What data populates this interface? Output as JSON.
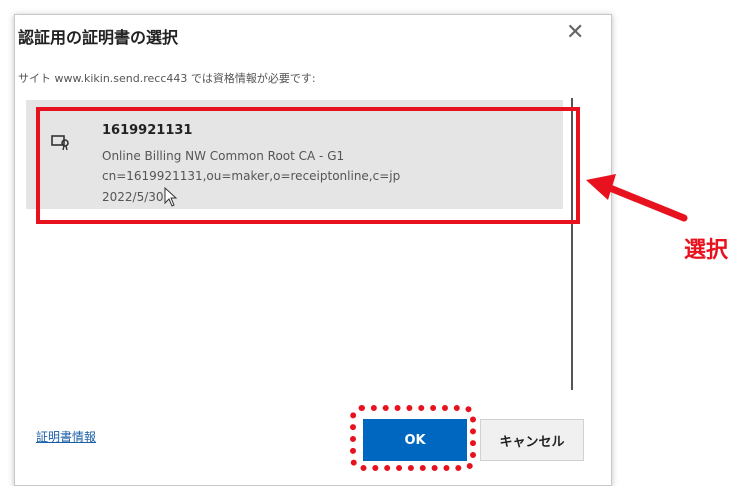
{
  "dialog": {
    "title": "認証用の証明書の選択",
    "subtitle": "サイト www.kikin.send.recc443 では資格情報が必要です:",
    "close_icon": "close-icon"
  },
  "certificate": {
    "name": "1619921131",
    "issuer": "Online Billing NW Common Root CA - G1",
    "subject": "cn=1619921131,ou=maker,o=receiptonline,c=jp",
    "date": "2022/5/30",
    "icon": "certificate-icon"
  },
  "footer": {
    "cert_info_link": "証明書情報",
    "ok_label": "OK",
    "cancel_label": "キャンセル"
  },
  "annotation": {
    "select_label": "選択",
    "accent_color": "#e8121f"
  }
}
